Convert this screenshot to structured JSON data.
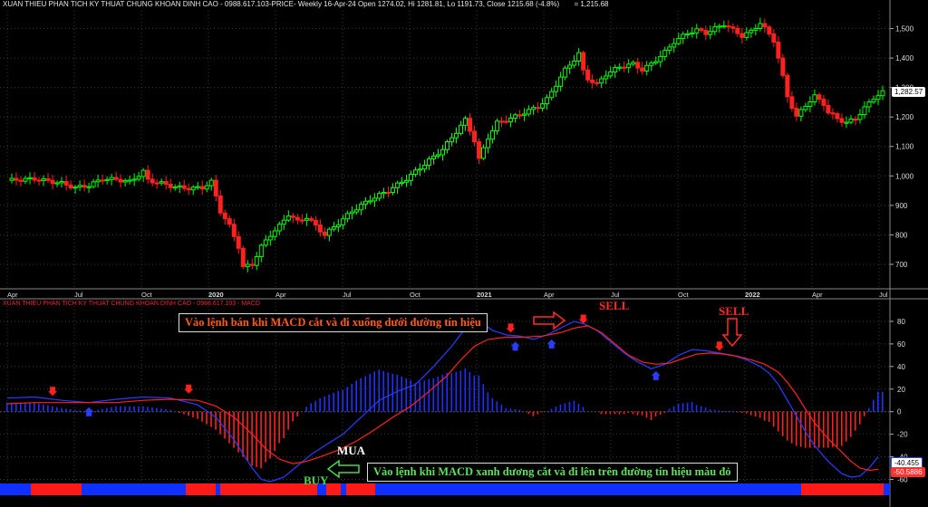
{
  "header": {
    "title": "XUAN THIEU PHAN TICH KY THUAT CHUNG KHOAN DINH CAO - 0988.617.103-PRICE- Weekly 16-Apr-24 Open 1274.02, Hi 1281.81, Lo 1191.73, Close 1215.68 (-4.8%)",
    "close_readout": "= 1,215.68"
  },
  "indicator_title": "XUAN THIEU PHAN TICH KY THUAT CHUNG KHOAN DINH CAO - 0988.617.103 - MACD",
  "annotations": {
    "sell_note": "Vào lệnh bán khi MACD cắt và đi xuống dưới đường tín hiệu",
    "buy_note": "Vào lệnh khi MACD xanh dương cắt và đi lên trên đường tín hiệu màu đỏ",
    "sell_label_1": "SELL",
    "sell_label_2": "SELL",
    "mua_label": "MUA",
    "buy_label": "BUY"
  },
  "value_tags": {
    "price_last": "1,282.57",
    "macd_last": "-40.455",
    "signal_last": "-50.5886"
  },
  "colors": {
    "up_candle": "#00ff00",
    "down_candle": "#ff2020",
    "macd_line": "#2b3cff",
    "signal_line": "#ff2020",
    "hist_pos": "#2030ff",
    "hist_neg": "#ff2020",
    "grid": "#3a3a3a"
  },
  "chart_data": [
    {
      "type": "candlestick",
      "title": "PRICE Weekly",
      "ylim": [
        620,
        1560
      ],
      "y_ticks": [
        700,
        800,
        900,
        1000,
        1100,
        1200,
        1300,
        1400,
        1500
      ],
      "y_tick_labels": [
        "700",
        "800",
        "900",
        "1,000",
        "1,100",
        "1,200",
        "1,300",
        "1,400",
        "1,500"
      ],
      "x_tick_labels": [
        "Apr",
        "Jul",
        "Oct",
        "2020",
        "Apr",
        "Jul",
        "Oct",
        "2021",
        "Apr",
        "Jul",
        "Oct",
        "2022",
        "Apr",
        "Jul"
      ],
      "bold_tick_labels": [
        "2020",
        "2021",
        "2022"
      ],
      "grid": true,
      "close_path": [
        [
          0,
          985
        ],
        [
          6,
          990
        ],
        [
          12,
          975
        ],
        [
          15,
          960
        ],
        [
          18,
          968
        ],
        [
          21,
          990
        ],
        [
          24,
          988
        ],
        [
          27,
          980
        ],
        [
          30,
          1015
        ],
        [
          31,
          985
        ],
        [
          34,
          975
        ],
        [
          37,
          962
        ],
        [
          40,
          958
        ],
        [
          43,
          960
        ],
        [
          45,
          980
        ],
        [
          47,
          880
        ],
        [
          49,
          830
        ],
        [
          51,
          760
        ],
        [
          52,
          690
        ],
        [
          54,
          700
        ],
        [
          56,
          760
        ],
        [
          58,
          800
        ],
        [
          60,
          830
        ],
        [
          62,
          870
        ],
        [
          64,
          845
        ],
        [
          66,
          860
        ],
        [
          68,
          830
        ],
        [
          70,
          800
        ],
        [
          73,
          840
        ],
        [
          76,
          880
        ],
        [
          80,
          920
        ],
        [
          84,
          950
        ],
        [
          88,
          990
        ],
        [
          92,
          1040
        ],
        [
          96,
          1090
        ],
        [
          99,
          1150
        ],
        [
          101,
          1190
        ],
        [
          103,
          1120
        ],
        [
          104,
          1055
        ],
        [
          106,
          1130
        ],
        [
          108,
          1180
        ],
        [
          111,
          1195
        ],
        [
          114,
          1215
        ],
        [
          117,
          1235
        ],
        [
          119,
          1260
        ],
        [
          121,
          1310
        ],
        [
          123,
          1360
        ],
        [
          125,
          1395
        ],
        [
          126,
          1415
        ],
        [
          127,
          1355
        ],
        [
          128,
          1330
        ],
        [
          130,
          1310
        ],
        [
          132,
          1345
        ],
        [
          135,
          1370
        ],
        [
          138,
          1380
        ],
        [
          140,
          1360
        ],
        [
          142,
          1380
        ],
        [
          145,
          1420
        ],
        [
          147,
          1455
        ],
        [
          150,
          1485
        ],
        [
          152,
          1495
        ],
        [
          154,
          1485
        ],
        [
          156,
          1500
        ],
        [
          158,
          1515
        ],
        [
          160,
          1495
        ],
        [
          162,
          1475
        ],
        [
          164,
          1490
        ],
        [
          166,
          1520
        ],
        [
          167,
          1500
        ],
        [
          169,
          1460
        ],
        [
          170,
          1400
        ],
        [
          172,
          1270
        ],
        [
          174,
          1200
        ],
        [
          176,
          1240
        ],
        [
          178,
          1270
        ],
        [
          180,
          1245
        ],
        [
          181,
          1215
        ],
        [
          183,
          1195
        ],
        [
          185,
          1180
        ],
        [
          187,
          1195
        ],
        [
          189,
          1230
        ],
        [
          191,
          1265
        ],
        [
          193,
          1283
        ]
      ],
      "last_value": "1,282.57"
    },
    {
      "type": "line",
      "title": "MACD",
      "ylim": [
        -62,
        92
      ],
      "y_ticks": [
        -60,
        -40,
        -20,
        0,
        20,
        40,
        60,
        80
      ],
      "y_tick_labels": [
        "-60",
        "-40",
        "-20",
        "0",
        "20",
        "40",
        "60",
        "80"
      ],
      "series": [
        {
          "name": "MACD",
          "values": [
            [
              0,
              12
            ],
            [
              6,
              13
            ],
            [
              12,
              10
            ],
            [
              18,
              8
            ],
            [
              24,
              11
            ],
            [
              30,
              13
            ],
            [
              36,
              12
            ],
            [
              42,
              6
            ],
            [
              46,
              -5
            ],
            [
              50,
              -25
            ],
            [
              54,
              -50
            ],
            [
              56,
              -60
            ],
            [
              58,
              -62
            ],
            [
              61,
              -58
            ],
            [
              64,
              -48
            ],
            [
              67,
              -38
            ],
            [
              70,
              -30
            ],
            [
              74,
              -20
            ],
            [
              78,
              -5
            ],
            [
              82,
              10
            ],
            [
              86,
              18
            ],
            [
              90,
              24
            ],
            [
              94,
              40
            ],
            [
              98,
              58
            ],
            [
              101,
              74
            ],
            [
              104,
              80
            ],
            [
              107,
              72
            ],
            [
              110,
              68
            ],
            [
              113,
              67
            ],
            [
              116,
              64
            ],
            [
              119,
              68
            ],
            [
              122,
              74
            ],
            [
              125,
              80
            ],
            [
              127,
              78
            ],
            [
              130,
              72
            ],
            [
              133,
              62
            ],
            [
              136,
              52
            ],
            [
              139,
              44
            ],
            [
              142,
              38
            ],
            [
              145,
              42
            ],
            [
              148,
              50
            ],
            [
              151,
              55
            ],
            [
              154,
              54
            ],
            [
              157,
              52
            ],
            [
              160,
              50
            ],
            [
              163,
              46
            ],
            [
              166,
              40
            ],
            [
              168,
              34
            ],
            [
              170,
              24
            ],
            [
              172,
              10
            ],
            [
              174,
              -4
            ],
            [
              176,
              -18
            ],
            [
              178,
              -30
            ],
            [
              181,
              -44
            ],
            [
              184,
              -55
            ],
            [
              186,
              -58
            ],
            [
              188,
              -57
            ],
            [
              190,
              -50
            ],
            [
              192,
              -40
            ]
          ]
        },
        {
          "name": "Signal",
          "values": [
            [
              0,
              7
            ],
            [
              6,
              8
            ],
            [
              12,
              8
            ],
            [
              18,
              8
            ],
            [
              24,
              8
            ],
            [
              30,
              10
            ],
            [
              36,
              11
            ],
            [
              42,
              10
            ],
            [
              46,
              5
            ],
            [
              50,
              -5
            ],
            [
              54,
              -20
            ],
            [
              57,
              -33
            ],
            [
              60,
              -42
            ],
            [
              63,
              -46
            ],
            [
              66,
              -44
            ],
            [
              69,
              -40
            ],
            [
              73,
              -34
            ],
            [
              77,
              -26
            ],
            [
              81,
              -16
            ],
            [
              85,
              -5
            ],
            [
              89,
              5
            ],
            [
              93,
              18
            ],
            [
              97,
              32
            ],
            [
              100,
              46
            ],
            [
              103,
              58
            ],
            [
              106,
              64
            ],
            [
              110,
              66
            ],
            [
              114,
              66
            ],
            [
              118,
              67
            ],
            [
              122,
              70
            ],
            [
              125,
              74
            ],
            [
              128,
              76
            ],
            [
              131,
              70
            ],
            [
              134,
              60
            ],
            [
              137,
              50
            ],
            [
              140,
              44
            ],
            [
              143,
              42
            ],
            [
              146,
              43
            ],
            [
              149,
              47
            ],
            [
              152,
              51
            ],
            [
              155,
              52
            ],
            [
              158,
              51
            ],
            [
              161,
              49
            ],
            [
              164,
              46
            ],
            [
              167,
              42
            ],
            [
              170,
              35
            ],
            [
              172,
              26
            ],
            [
              174,
              15
            ],
            [
              176,
              2
            ],
            [
              178,
              -10
            ],
            [
              181,
              -24
            ],
            [
              184,
              -36
            ],
            [
              186,
              -44
            ],
            [
              188,
              -50
            ],
            [
              190,
              -52
            ],
            [
              192,
              -51
            ]
          ]
        }
      ],
      "last_values": {
        "MACD": "-40.455",
        "Signal": "-50.5886"
      }
    }
  ]
}
